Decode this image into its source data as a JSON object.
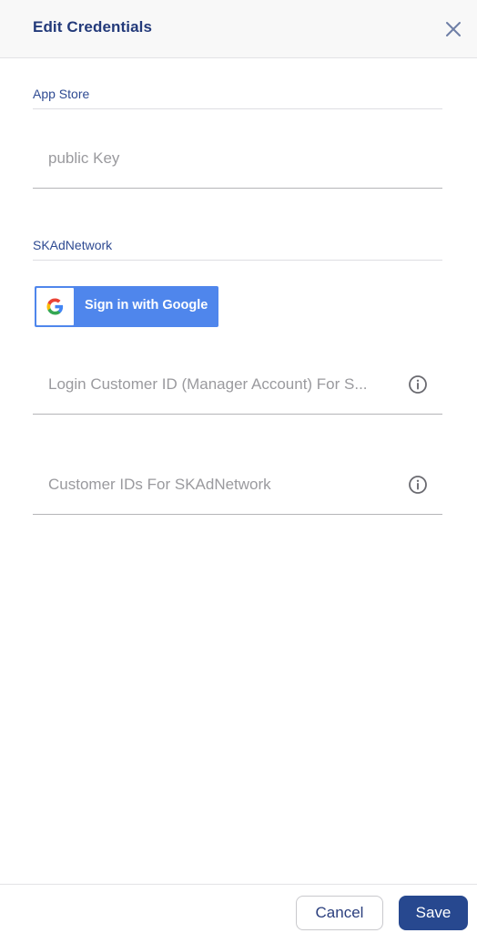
{
  "header": {
    "title": "Edit Credentials",
    "close_icon": "close-icon"
  },
  "app_store": {
    "section_label": "App Store",
    "public_key": {
      "value": "",
      "placeholder": "public Key"
    }
  },
  "skadnetwork": {
    "section_label": "SKAdNetwork",
    "google_button": {
      "label": "Sign in with Google",
      "icon": "google-logo-icon"
    },
    "login_customer_id": {
      "value": "",
      "placeholder": "Login Customer ID (Manager Account) For S...",
      "info_icon": "info-icon"
    },
    "customer_ids": {
      "value": "",
      "placeholder": "Customer IDs For SKAdNetwork",
      "info_icon": "info-icon"
    }
  },
  "footer": {
    "cancel_label": "Cancel",
    "save_label": "Save"
  },
  "colors": {
    "title": "#233a7a",
    "section_label": "#2e4a92",
    "google_blue": "#4f86ec",
    "save_button": "#27488f"
  }
}
